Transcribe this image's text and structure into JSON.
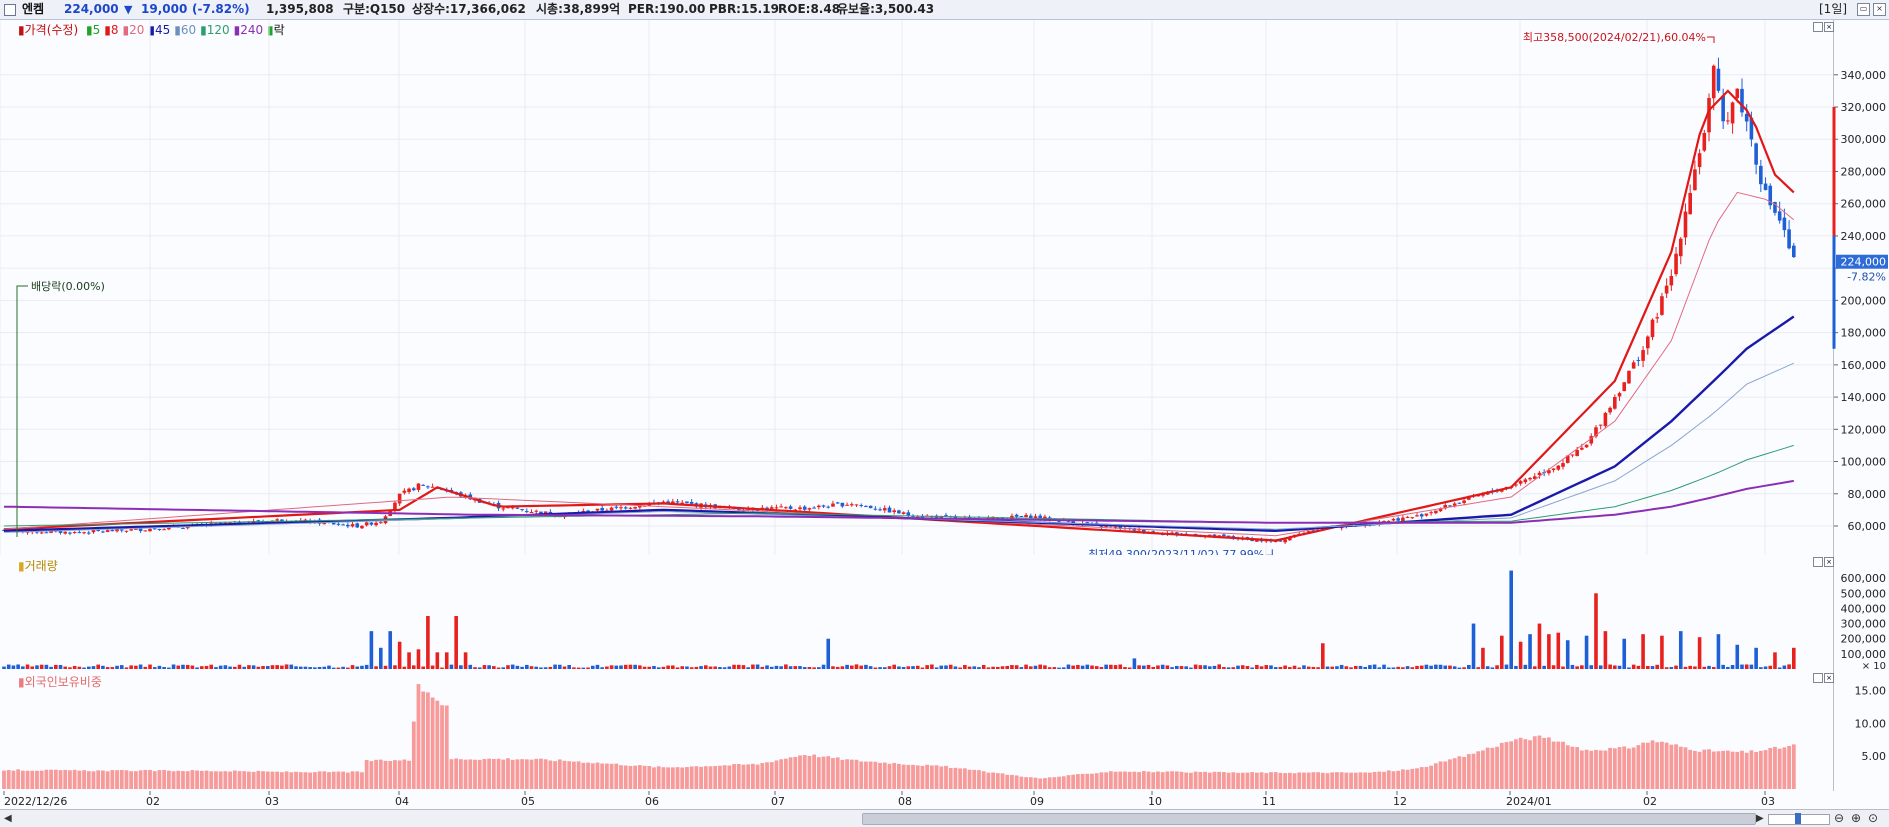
{
  "header": {
    "name": "엔켐",
    "price": "224,000",
    "arrow": "▼",
    "change": "19,000",
    "pct": "(-7.82%)",
    "volume": "1,395,808",
    "market": "구분:Q150",
    "shares": "상장수:17,366,062",
    "mcap": "시총:38,899억",
    "per": "PER:190.00",
    "pbr": "PBR:15.19",
    "roe": "ROE:8.48",
    "reserve": "유보율:3,500.43",
    "period": "[1일]"
  },
  "colors": {
    "up": "#e8211f",
    "down": "#1f5fd6",
    "ma5": "#e01818",
    "ma8": "#2aa832",
    "ma20": "#e06a7f",
    "ma45": "#1a1aa8",
    "ma60": "#8aa6cf",
    "ma120": "#2f9c70",
    "ma240": "#8a2fb5"
  },
  "legend": {
    "price": "가격(수정)",
    "ma": [
      {
        "label": "5",
        "color": "#21a32a"
      },
      {
        "label": "8",
        "color": "#e01818"
      },
      {
        "label": "20",
        "color": "#e06a7f"
      },
      {
        "label": "45",
        "color": "#1a1aa8"
      },
      {
        "label": "60",
        "color": "#6c8fc2"
      },
      {
        "label": "120",
        "color": "#2f9c70"
      },
      {
        "label": "240",
        "color": "#8a2fb5"
      }
    ],
    "ex": "락",
    "volume": "거래량",
    "foreign": "외국인보유비중"
  },
  "annotations": {
    "high": "최고358,500(2024/02/21),60.04%",
    "low": "최저49,300(2023/11/02),77.99%",
    "dividend": "배당락(0.00%)",
    "current_price": "224,000",
    "current_pct": "-7.82%",
    "volume_unit": "× 10"
  },
  "chart_data": [
    {
      "type": "candlestick",
      "title": "엔켐 가격(수정)",
      "x_tick_labels": [
        "2022/12/26",
        "02",
        "03",
        "04",
        "05",
        "06",
        "07",
        "08",
        "09",
        "10",
        "11",
        "12",
        "2024/01",
        "02",
        "03"
      ],
      "y_ticks": [
        60000,
        80000,
        100000,
        120000,
        140000,
        160000,
        180000,
        200000,
        220000,
        240000,
        260000,
        280000,
        300000,
        320000,
        340000
      ],
      "y_tick_labels": [
        "60,000",
        "80,000",
        "100,000",
        "120,000",
        "140,000",
        "160,000",
        "180,000",
        "200,000",
        "220,000",
        "240,000",
        "260,000",
        "280,000",
        "300,000",
        "320,000",
        "340,000"
      ],
      "ylim": [
        42000,
        374000
      ],
      "close_path": [
        [
          0,
          57000
        ],
        [
          15,
          56000
        ],
        [
          30,
          58000
        ],
        [
          45,
          61000
        ],
        [
          60,
          64000
        ],
        [
          75,
          60000
        ],
        [
          80,
          63000
        ],
        [
          84,
          79000
        ],
        [
          88,
          85000
        ],
        [
          92,
          84000
        ],
        [
          97,
          79000
        ],
        [
          105,
          72000
        ],
        [
          118,
          67000
        ],
        [
          130,
          71000
        ],
        [
          140,
          75000
        ],
        [
          155,
          71000
        ],
        [
          170,
          71000
        ],
        [
          180,
          74000
        ],
        [
          192,
          67000
        ],
        [
          205,
          64000
        ],
        [
          218,
          66000
        ],
        [
          230,
          61000
        ],
        [
          245,
          56000
        ],
        [
          260,
          53000
        ],
        [
          270,
          50000
        ],
        [
          278,
          58000
        ],
        [
          290,
          62000
        ],
        [
          300,
          66000
        ],
        [
          310,
          76000
        ],
        [
          320,
          85000
        ],
        [
          330,
          98000
        ],
        [
          336,
          110000
        ],
        [
          342,
          140000
        ],
        [
          348,
          170000
        ],
        [
          354,
          215000
        ],
        [
          358,
          270000
        ],
        [
          361,
          305000
        ],
        [
          363,
          340000
        ],
        [
          365,
          310000
        ],
        [
          368,
          330000
        ],
        [
          371,
          300000
        ],
        [
          374,
          265000
        ],
        [
          377,
          250000
        ],
        [
          380,
          224000
        ]
      ],
      "high": {
        "value": 358500,
        "date": "2024/02/21",
        "pct": "60.04%"
      },
      "low": {
        "value": 49300,
        "date": "2023/11/02",
        "pct": "77.99%"
      },
      "last": {
        "close": 224000,
        "change": -19000,
        "pct": -7.82
      },
      "moving_averages": [
        {
          "name": "5",
          "values": [
            [
              0,
              58000
            ],
            [
              84,
              70000
            ],
            [
              92,
              84000
            ],
            [
              105,
              72000
            ],
            [
              140,
              74000
            ],
            [
              270,
              51000
            ],
            [
              320,
              84000
            ],
            [
              342,
              150000
            ],
            [
              354,
              230000
            ],
            [
              361,
              315000
            ],
            [
              366,
              330000
            ],
            [
              371,
              315000
            ],
            [
              376,
              278000
            ],
            [
              380,
              267000
            ]
          ]
        },
        {
          "name": "20",
          "values": [
            [
              0,
              58000
            ],
            [
              95,
              78000
            ],
            [
              140,
              72000
            ],
            [
              270,
              54000
            ],
            [
              320,
              78000
            ],
            [
              342,
              125000
            ],
            [
              354,
              175000
            ],
            [
              363,
              245000
            ],
            [
              368,
              267000
            ],
            [
              375,
              262000
            ],
            [
              380,
              250000
            ]
          ]
        },
        {
          "name": "45",
          "values": [
            [
              0,
              57000
            ],
            [
              95,
              65000
            ],
            [
              140,
              70000
            ],
            [
              270,
              57000
            ],
            [
              320,
              67000
            ],
            [
              342,
              97000
            ],
            [
              354,
              125000
            ],
            [
              363,
              150000
            ],
            [
              370,
              170000
            ],
            [
              380,
              190000
            ]
          ]
        },
        {
          "name": "60",
          "values": [
            [
              0,
              56000
            ],
            [
              100,
              65000
            ],
            [
              140,
              69000
            ],
            [
              270,
              58000
            ],
            [
              320,
              65000
            ],
            [
              342,
              88000
            ],
            [
              354,
              110000
            ],
            [
              363,
              130000
            ],
            [
              370,
              148000
            ],
            [
              380,
              161000
            ]
          ]
        },
        {
          "name": "120",
          "values": [
            [
              0,
              60000
            ],
            [
              100,
              65000
            ],
            [
              160,
              68000
            ],
            [
              270,
              62000
            ],
            [
              320,
              63000
            ],
            [
              342,
              72000
            ],
            [
              354,
              82000
            ],
            [
              363,
              92000
            ],
            [
              370,
              101000
            ],
            [
              380,
              110000
            ]
          ]
        },
        {
          "name": "240",
          "values": [
            [
              0,
              72000
            ],
            [
              100,
              67000
            ],
            [
              160,
              66000
            ],
            [
              270,
              62000
            ],
            [
              320,
              62000
            ],
            [
              342,
              67000
            ],
            [
              354,
              72000
            ],
            [
              363,
              78000
            ],
            [
              370,
              83000
            ],
            [
              380,
              88000
            ]
          ]
        }
      ]
    },
    {
      "type": "bar",
      "title": "거래량",
      "y_ticks": [
        100000,
        200000,
        300000,
        400000,
        500000,
        600000
      ],
      "y_tick_labels": [
        "100,000",
        "200,000",
        "300,000",
        "400,000",
        "500,000",
        "600,000"
      ],
      "ylim": [
        0,
        700000
      ],
      "unit": "× 10",
      "baseline": 18000,
      "spikes": [
        [
          78,
          250000
        ],
        [
          80,
          140000
        ],
        [
          82,
          250000
        ],
        [
          84,
          180000
        ],
        [
          86,
          110000
        ],
        [
          88,
          130000
        ],
        [
          90,
          350000
        ],
        [
          92,
          110000
        ],
        [
          94,
          110000
        ],
        [
          96,
          350000
        ],
        [
          98,
          110000
        ],
        [
          175,
          200000
        ],
        [
          240,
          70000
        ],
        [
          280,
          170000
        ],
        [
          312,
          300000
        ],
        [
          314,
          140000
        ],
        [
          318,
          220000
        ],
        [
          320,
          650000
        ],
        [
          322,
          180000
        ],
        [
          324,
          230000
        ],
        [
          326,
          300000
        ],
        [
          328,
          230000
        ],
        [
          330,
          240000
        ],
        [
          332,
          190000
        ],
        [
          336,
          220000
        ],
        [
          338,
          500000
        ],
        [
          340,
          250000
        ],
        [
          344,
          200000
        ],
        [
          348,
          230000
        ],
        [
          352,
          220000
        ],
        [
          356,
          250000
        ],
        [
          360,
          210000
        ],
        [
          364,
          230000
        ],
        [
          368,
          160000
        ],
        [
          372,
          140000
        ],
        [
          376,
          110000
        ],
        [
          380,
          140000
        ]
      ]
    },
    {
      "type": "bar",
      "title": "외국인보유비중",
      "y_ticks": [
        5,
        10,
        15
      ],
      "y_tick_labels": [
        "5.00",
        "10.00",
        "15.00"
      ],
      "ylim": [
        0,
        18
      ],
      "values_path": [
        [
          0,
          2.9
        ],
        [
          20,
          2.8
        ],
        [
          40,
          2.8
        ],
        [
          60,
          2.6
        ],
        [
          76,
          2.6
        ],
        [
          77,
          4.3
        ],
        [
          86,
          4.4
        ],
        [
          88,
          15.4
        ],
        [
          90,
          14.8
        ],
        [
          92,
          13.8
        ],
        [
          94,
          12.4
        ],
        [
          95,
          4.6
        ],
        [
          110,
          4.6
        ],
        [
          120,
          4.3
        ],
        [
          140,
          3.3
        ],
        [
          160,
          3.8
        ],
        [
          170,
          5.3
        ],
        [
          180,
          4.4
        ],
        [
          200,
          3.4
        ],
        [
          220,
          1.6
        ],
        [
          235,
          2.7
        ],
        [
          260,
          2.5
        ],
        [
          290,
          2.5
        ],
        [
          300,
          3.1
        ],
        [
          310,
          5.0
        ],
        [
          320,
          7.4
        ],
        [
          327,
          8.0
        ],
        [
          335,
          5.9
        ],
        [
          345,
          6.3
        ],
        [
          350,
          7.4
        ],
        [
          360,
          5.9
        ],
        [
          370,
          5.6
        ],
        [
          375,
          6.1
        ],
        [
          380,
          6.6
        ]
      ]
    }
  ]
}
